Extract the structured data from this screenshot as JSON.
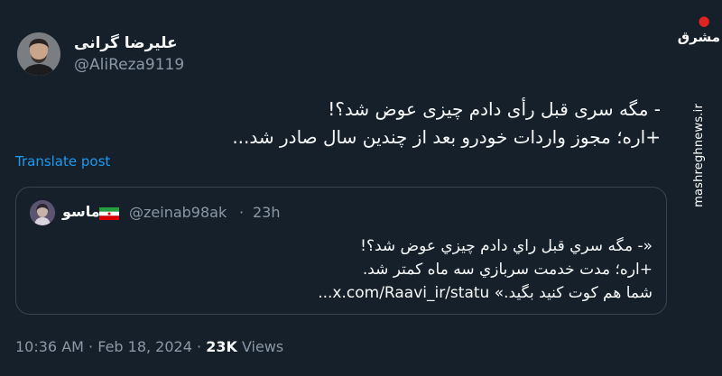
{
  "tweet": {
    "author_name": "علیرضا گرانی",
    "author_handle": "@AliReza9119",
    "lines": [
      "- مگه سری قبل رأی دادم چیزی عوض شد؟!",
      "+اره؛ مجوز واردات خودرو بعد از چندین سال صادر شد..."
    ],
    "translate_label": "Translate post",
    "time": "10:36 AM",
    "separator": "·",
    "date": "Feb 18, 2024",
    "views_count": "23K",
    "views_label": "Views"
  },
  "quote": {
    "author_name": "ماسو",
    "author_handle": "@zeinab98ak",
    "separator": "·",
    "time": "23h",
    "lines": [
      "«- مگه سري قبل راي دادم چيزي عوض شد؟!",
      "+اره؛ مدت خدمت سربازي سه ماه کمتر شد.",
      "شما هم کوت کنید بگید.» x.com/Raavi_ir/statu..."
    ]
  },
  "watermark": {
    "logo_text": "مشرق",
    "url": "mashreghnews.ir"
  },
  "colors": {
    "background": "#15202b",
    "text": "#f7f9f9",
    "secondary": "#8b98a5",
    "link": "#1d9bf0",
    "border": "#38444d",
    "watermark_accent": "#e0241f"
  }
}
